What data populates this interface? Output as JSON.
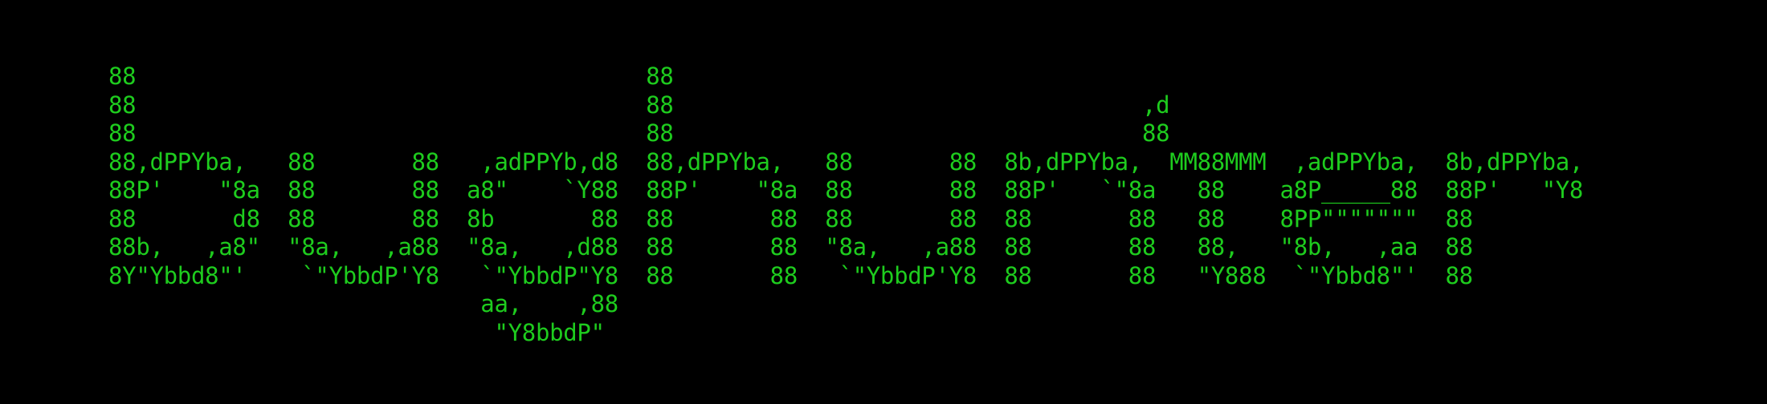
{
  "terminal": {
    "text_color": "#1ecc1e",
    "background_color": "#000000"
  },
  "banner": {
    "lines": [
      "88                                     88",
      "88                                     88                                  ,d",
      "88                                     88                                  88",
      "88,dPPYba,   88       88   ,adPPYb,d8  88,dPPYba,   88       88  8b,dPPYba,  MM88MMM  ,adPPYba,  8b,dPPYba,",
      "88P'    \"8a  88       88  a8\"    `Y88  88P'    \"8a  88       88  88P'   `\"8a   88    a8P_____88  88P'   \"Y8",
      "88       d8  88       88  8b       88  88       88  88       88  88       88   88    8PP\"\"\"\"\"\"\"  88",
      "88b,   ,a8\"  \"8a,   ,a88  \"8a,   ,d88  88       88  \"8a,   ,a88  88       88   88,   \"8b,   ,aa  88",
      "8Y\"Ybbd8\"'    `\"YbbdP'Y8   `\"YbbdP\"Y8  88       88   `\"YbbdP'Y8  88       88   \"Y888  `\"Ybbd8\"'  88",
      "                           aa,    ,88",
      "                            \"Y8bbdP\""
    ]
  }
}
